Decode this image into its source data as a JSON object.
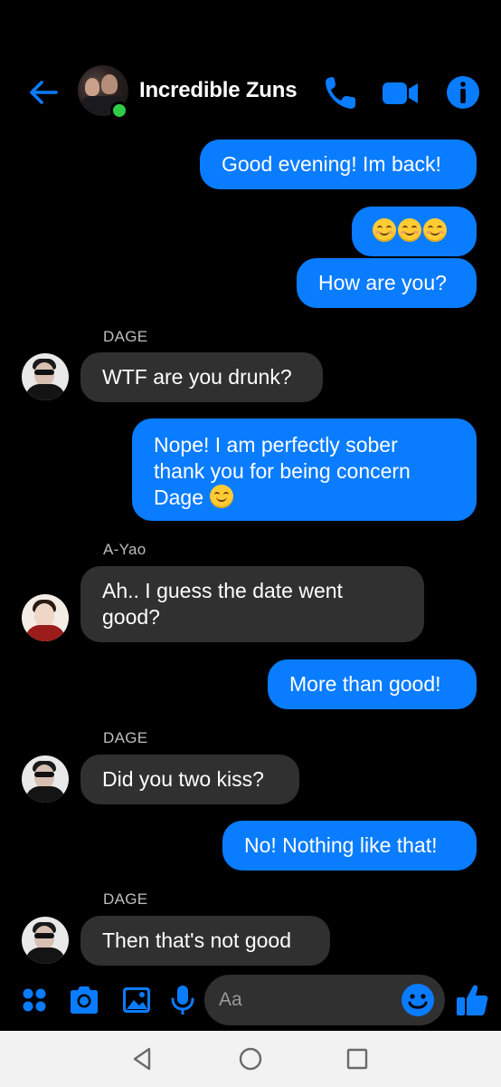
{
  "header": {
    "title": "Incredible Zuns",
    "icons": [
      "back-arrow-icon",
      "phone-icon",
      "video-camera-icon",
      "info-icon"
    ],
    "online": true
  },
  "messages": {
    "m1": "Good evening! Im back!",
    "m3": "How are you?",
    "m4_sender": "DAGE",
    "m4": "WTF are you drunk?",
    "m5_line1": "Nope! I am perfectly sober",
    "m5_line2": "thank you for being concern",
    "m5_line3": "Dage",
    "m6_sender": "A-Yao",
    "m6_line1": "Ah.. I guess the date went",
    "m6_line2": "good?",
    "m7": "More than good!",
    "m8_sender": "DAGE",
    "m8": "Did you two kiss?",
    "m9": "No! Nothing like that!",
    "m10_sender": "DAGE",
    "m10": "Then that's not good"
  },
  "composer": {
    "placeholder": "Aa",
    "icons": [
      "apps-icon",
      "camera-icon",
      "gallery-icon",
      "microphone-icon",
      "emoji-icon",
      "thumbs-up-icon"
    ]
  },
  "colors": {
    "accent": "#0a7cff",
    "outgoing_bubble": "#0a7cff",
    "incoming_bubble": "#303030",
    "background": "#000000",
    "online": "#31cc46"
  }
}
